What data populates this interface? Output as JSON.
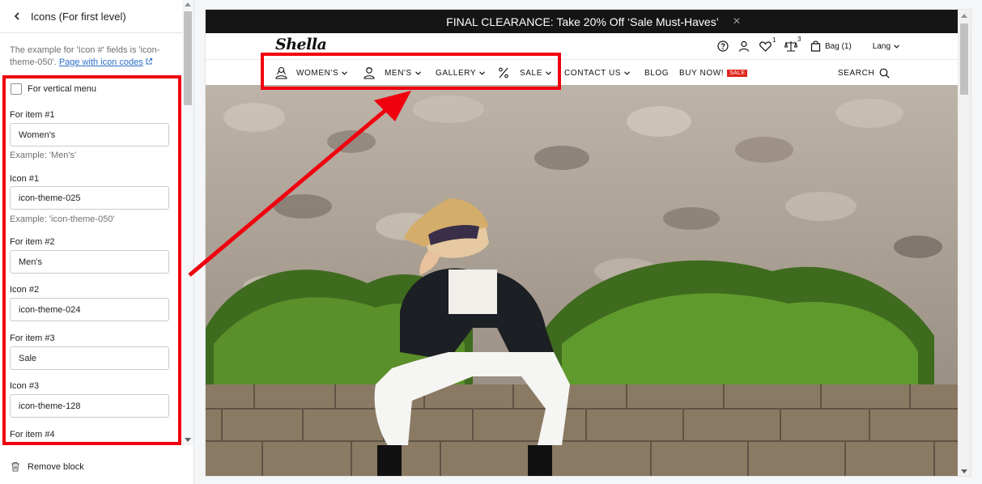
{
  "panel": {
    "title": "Icons (For first level)",
    "info_prefix": "The example for 'Icon #' fields is 'icon-theme-050'.",
    "info_link": "Page with icon codes",
    "vertical_menu_label": "For vertical menu",
    "fields": [
      {
        "label": "For item #1",
        "value": "Women's",
        "help": "Example: 'Men's'"
      },
      {
        "label": "Icon #1",
        "value": "icon-theme-025",
        "help": "Example: 'icon-theme-050'"
      },
      {
        "label": "For item #2",
        "value": "Men's",
        "help": ""
      },
      {
        "label": "Icon #2",
        "value": "icon-theme-024",
        "help": ""
      },
      {
        "label": "For item #3",
        "value": "Sale",
        "help": ""
      },
      {
        "label": "Icon #3",
        "value": "icon-theme-128",
        "help": ""
      },
      {
        "label": "For item #4",
        "value": "",
        "help": ""
      }
    ],
    "remove_label": "Remove block"
  },
  "preview": {
    "announcement": "FINAL CLEARANCE: Take 20% Off ‘Sale Must-Haves’",
    "logo": "Shella",
    "header": {
      "wishlist_count": "1",
      "compare_count": "3",
      "bag_label": "Bag (1)",
      "lang_label": "Lang"
    },
    "nav": {
      "womens": "WOMEN'S",
      "mens": "MEN'S",
      "gallery": "GALLERY",
      "sale": "SALE",
      "contact": "CONTACT US",
      "blog": "BLOG",
      "buy_now": "BUY NOW!",
      "sale_badge": "SALE",
      "search": "SEARCH"
    }
  },
  "colors": {
    "highlight": "#f0000f",
    "announcement_bg": "#151515",
    "link": "#2c6ecb",
    "sale_badge": "#e1251b"
  }
}
